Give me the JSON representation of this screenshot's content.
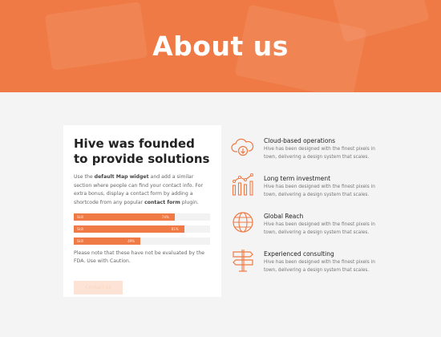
{
  "hero": {
    "title": "About us"
  },
  "card": {
    "title": "Hive was founded to provide solutions",
    "text_parts": {
      "p1": "Use the ",
      "b1": "default Map widget",
      "p2": " and add a similar section where people can find your contact info. For extra bonus, display a contact form by adding a shortcode from any popular ",
      "b2": "contact form",
      "p3": " plugin."
    },
    "bars": [
      {
        "label": "Skill",
        "value": 74,
        "pct_text": "74%"
      },
      {
        "label": "Skill",
        "value": 81,
        "pct_text": "81%"
      },
      {
        "label": "Skill",
        "value": 49,
        "pct_text": "49%"
      }
    ],
    "note": "Please note that these have not be evaluated by the FDA. Use with Caution.",
    "cta_label": "Contact us"
  },
  "features": [
    {
      "title": "Cloud-based operations",
      "desc": "Hive has been designed with the finest pixels in town, delivering a design system that scales.",
      "icon": "cloud-download-icon"
    },
    {
      "title": "Long term investment",
      "desc": "Hive has been designed with the finest pixels in town, delivering a design system that scales.",
      "icon": "bar-chart-icon"
    },
    {
      "title": "Global Reach",
      "desc": "Hive has been designed with the finest pixels in town, delivering a design system that scales.",
      "icon": "globe-icon"
    },
    {
      "title": "Experienced consulting",
      "desc": "Hive has been designed with the finest pixels in town, delivering a design system that scales.",
      "icon": "signpost-icon"
    }
  ],
  "colors": {
    "accent": "#ef7a45",
    "background": "#f4f4f4"
  }
}
